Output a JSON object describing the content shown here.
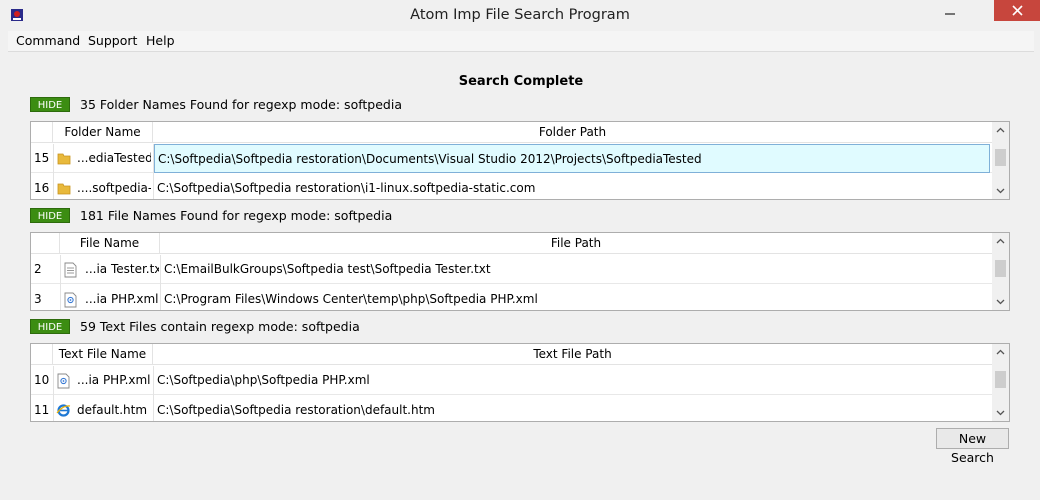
{
  "window": {
    "title": "Atom Imp File Search Program"
  },
  "menu": {
    "items": [
      "Command",
      "Support",
      "Help"
    ]
  },
  "status": {
    "heading": "Search Complete"
  },
  "folders": {
    "hide_label": "HIDE",
    "summary": "35 Folder Names Found for regexp mode: softpedia",
    "col_name": "Folder Name",
    "col_path": "Folder Path",
    "rows": [
      {
        "num": "15",
        "name": "...ediaTested",
        "path": "C:\\Softpedia\\Softpedia restoration\\Documents\\Visual Studio 2012\\Projects\\SoftpediaTested",
        "icon": "folder-icon"
      },
      {
        "num": "16",
        "name": "....softpedia-",
        "path": "C:\\Softpedia\\Softpedia restoration\\i1-linux.softpedia-static.com",
        "icon": "folder-icon"
      }
    ]
  },
  "files": {
    "hide_label": "HIDE",
    "summary": "181 File Names Found for regexp mode: softpedia",
    "col_name": "File Name",
    "col_path": "File Path",
    "rows": [
      {
        "num": "2",
        "name": "...ia Tester.txt",
        "path": "C:\\EmailBulkGroups\\Softpedia test\\Softpedia Tester.txt",
        "icon": "text-file-icon"
      },
      {
        "num": "3",
        "name": "...ia PHP.xml",
        "path": "C:\\Program Files\\Windows Center\\temp\\php\\Softpedia PHP.xml",
        "icon": "xml-file-icon"
      }
    ]
  },
  "texts": {
    "hide_label": "HIDE",
    "summary": "59 Text Files contain regexp mode: softpedia",
    "col_name": "Text File Name",
    "col_path": "Text File Path",
    "rows": [
      {
        "num": "10",
        "name": "...ia PHP.xml",
        "path": "C:\\Softpedia\\php\\Softpedia PHP.xml",
        "icon": "xml-file-icon"
      },
      {
        "num": "11",
        "name": "default.htm",
        "path": "C:\\Softpedia\\Softpedia restoration\\default.htm",
        "icon": "ie-html-icon"
      }
    ]
  },
  "actions": {
    "new_search": "New Search"
  },
  "colors": {
    "hide_button": "#3c8d12",
    "selection": "#e0fbff",
    "close_button": "#c7463d"
  }
}
